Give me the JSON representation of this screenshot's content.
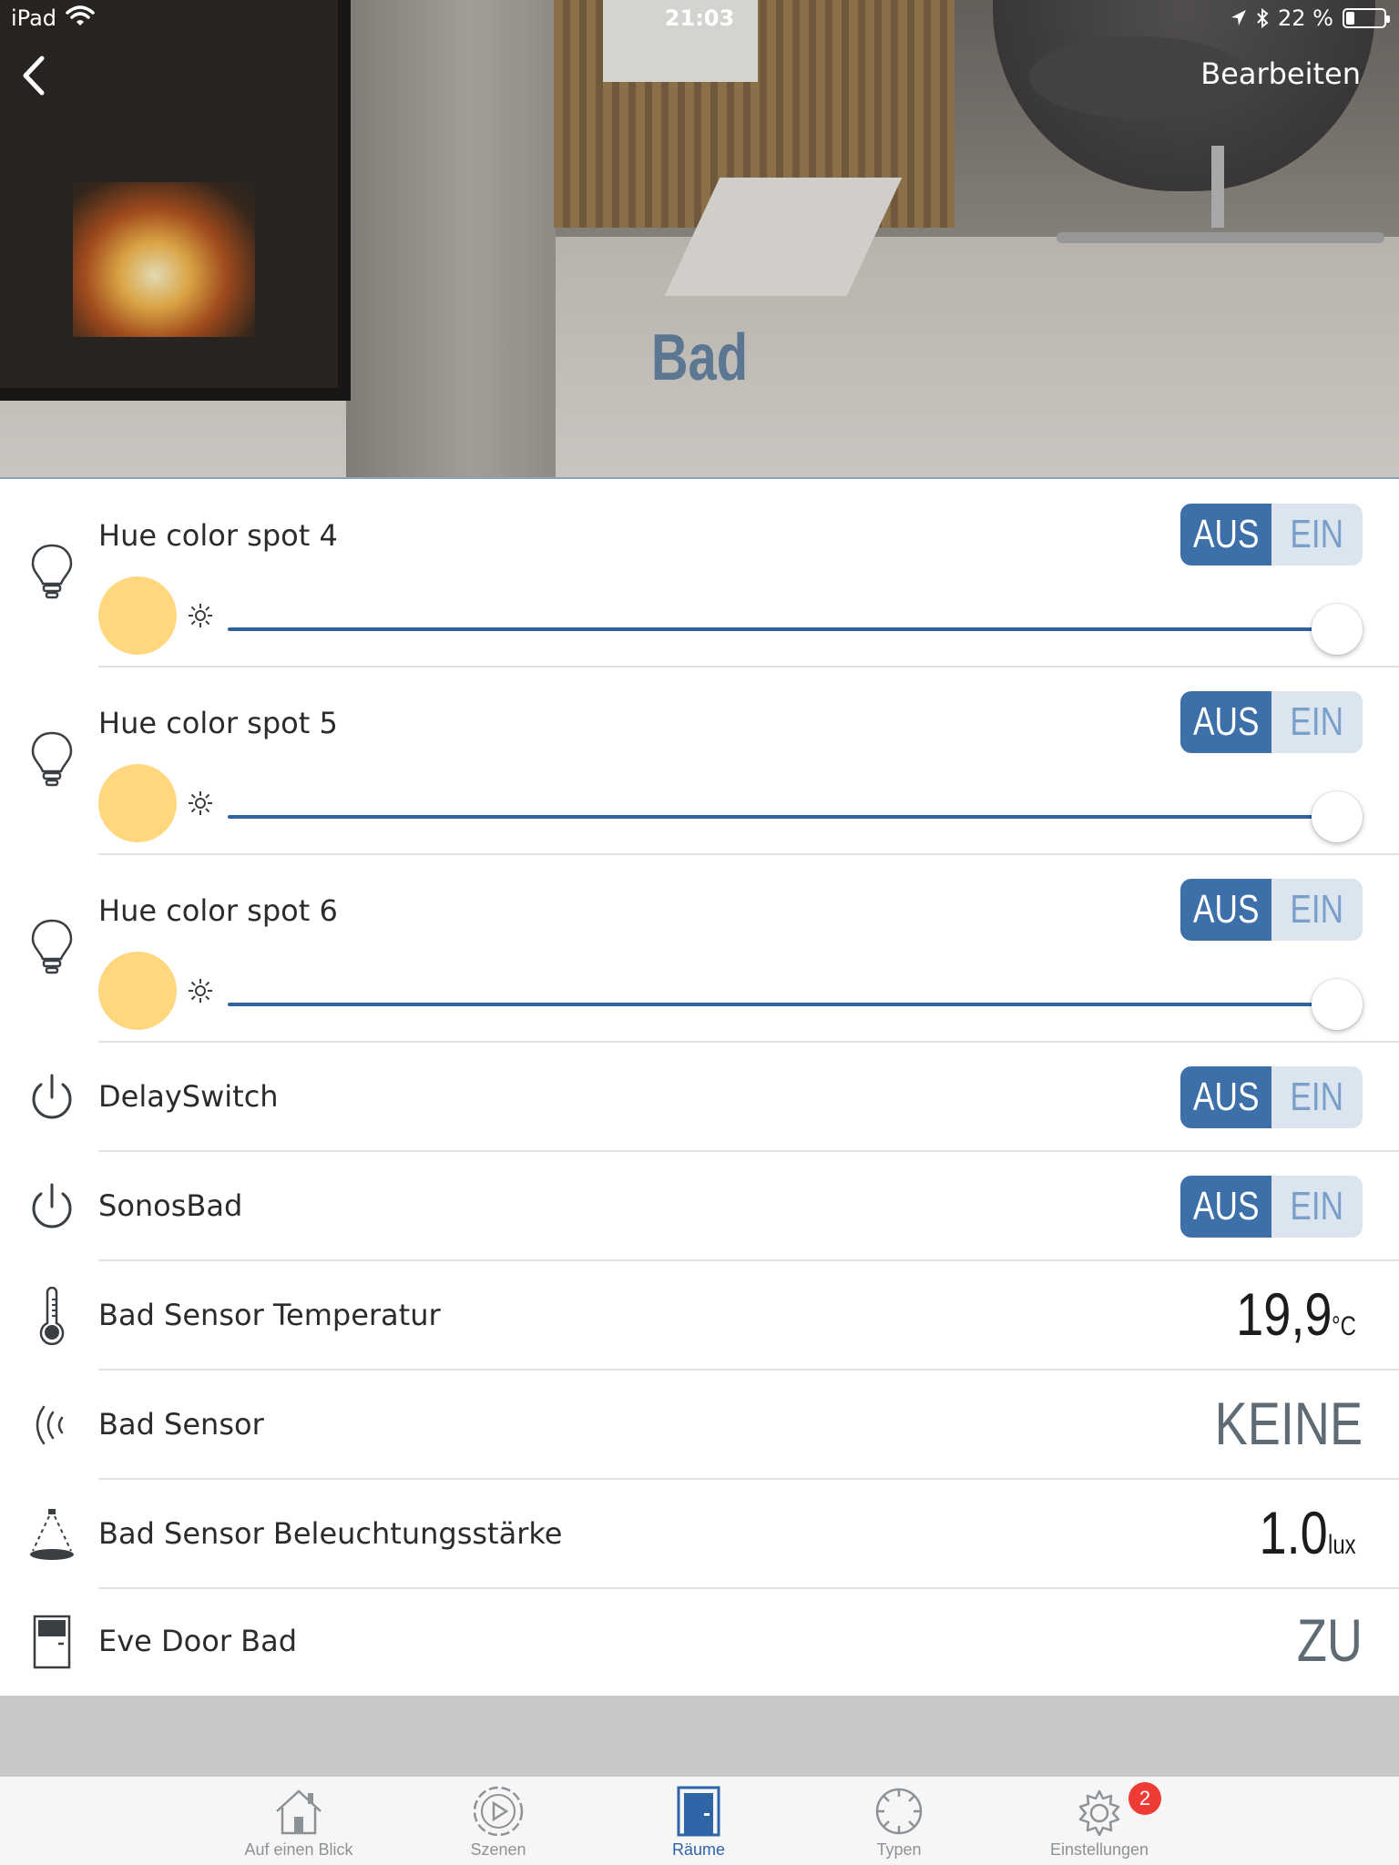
{
  "status_bar": {
    "device": "iPad",
    "time": "21:03",
    "battery": "22 %",
    "battery_level": 0.22
  },
  "nav": {
    "edit_label": "Bearbeiten"
  },
  "room": {
    "title": "Bad"
  },
  "colors": {
    "accent": "#3d6fa8",
    "toggle_bg": "#dbe5f0",
    "light_color": "#ffd77e",
    "badge": "#ee3b33"
  },
  "lights": [
    {
      "name": "Hue color spot 4",
      "off_label": "AUS",
      "on_label": "EIN",
      "brightness": 1.0,
      "icon": "lightbulb-icon"
    },
    {
      "name": "Hue color spot 5",
      "off_label": "AUS",
      "on_label": "EIN",
      "brightness": 1.0,
      "icon": "lightbulb-icon"
    },
    {
      "name": "Hue color spot 6",
      "off_label": "AUS",
      "on_label": "EIN",
      "brightness": 1.0,
      "icon": "lightbulb-icon"
    }
  ],
  "switches": [
    {
      "name": "DelaySwitch",
      "off_label": "AUS",
      "on_label": "EIN",
      "icon": "power-icon"
    },
    {
      "name": "SonosBad",
      "off_label": "AUS",
      "on_label": "EIN",
      "icon": "power-icon"
    }
  ],
  "sensors": [
    {
      "name": "Bad Sensor Temperatur",
      "value": "19,9",
      "unit": "°C",
      "icon": "thermometer-icon"
    },
    {
      "name": "Bad Sensor",
      "value": "KEINE",
      "unit": "",
      "icon": "motion-sensor-icon"
    },
    {
      "name": "Bad Sensor Beleuchtungsstärke",
      "value": "1.0",
      "unit": "lux",
      "icon": "light-sensor-icon"
    },
    {
      "name": "Eve Door Bad",
      "value": "ZU",
      "unit": "",
      "icon": "door-icon"
    }
  ],
  "tabs": [
    {
      "label": "Auf einen Blick",
      "icon": "house-icon"
    },
    {
      "label": "Szenen",
      "icon": "scenes-icon"
    },
    {
      "label": "Räume",
      "icon": "door-icon"
    },
    {
      "label": "Typen",
      "icon": "types-icon"
    },
    {
      "label": "Einstellungen",
      "icon": "gear-icon",
      "badge": "2"
    }
  ]
}
